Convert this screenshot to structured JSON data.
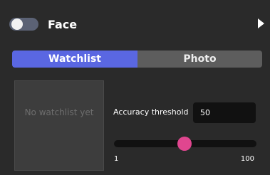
{
  "header": {
    "title": "Face",
    "toggle_on": false,
    "expand_icon": "chevron-right-icon"
  },
  "tabs": [
    {
      "label": "Watchlist",
      "active": true
    },
    {
      "label": "Photo",
      "active": false
    }
  ],
  "watchlist": {
    "empty_text": "No watchlist yet"
  },
  "accuracy": {
    "label": "Accuracy threshold",
    "value": "50",
    "slider_min": "1",
    "slider_max": "100",
    "slider_value": 50
  },
  "colors": {
    "background": "#2a2a2a",
    "accent": "#5a67e2",
    "slider_thumb": "#e0468f",
    "inactive_tab": "#5d5d5d"
  }
}
